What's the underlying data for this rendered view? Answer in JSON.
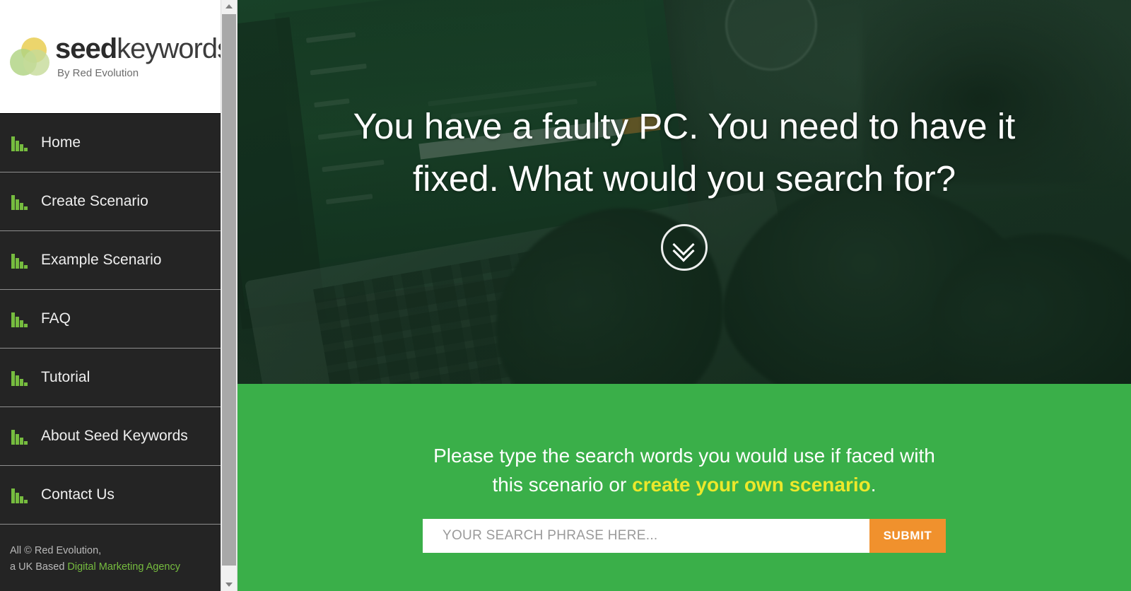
{
  "sidebar": {
    "logo": {
      "word_bold": "seed",
      "word_light": "keywords",
      "tagline": "By Red Evolution",
      "mark_colors": [
        "#e9ce52",
        "#b0d382",
        "#c6db98"
      ]
    },
    "nav_items": [
      {
        "label": "Home",
        "icon": "bar-chart-icon"
      },
      {
        "label": "Create Scenario",
        "icon": "bar-chart-icon"
      },
      {
        "label": "Example Scenario",
        "icon": "bar-chart-icon"
      },
      {
        "label": "FAQ",
        "icon": "bar-chart-icon"
      },
      {
        "label": "Tutorial",
        "icon": "bar-chart-icon"
      },
      {
        "label": "About Seed Keywords",
        "icon": "bar-chart-icon"
      },
      {
        "label": "Contact Us",
        "icon": "bar-chart-icon"
      }
    ],
    "footer": {
      "line1": "All © Red Evolution,",
      "line2_prefix": "a UK Based ",
      "line2_link": "Digital Marketing Agency"
    }
  },
  "scrollbar": {
    "up_arrow": "triangle-up-icon",
    "down_arrow": "triangle-down-icon",
    "thumb": "scrollbar-thumb"
  },
  "hero": {
    "title": "You have a faulty PC. You need to have it fixed. What would you search for?",
    "scroll_icon": "double-chevron-down-icon"
  },
  "green_section": {
    "copy_part1": "Please type the search words you would use if faced with this scenario or ",
    "copy_link": "create your own scenario",
    "copy_part2": ".",
    "search_placeholder": "YOUR SEARCH PHRASE HERE...",
    "search_value": "",
    "submit_label": "SUBMIT"
  },
  "colors": {
    "brand_green": "#3aaf49",
    "icon_green": "#76bc3f",
    "link_yellow": "#ece82b",
    "submit_orange": "#f0912d",
    "sidebar_dark": "#242424"
  }
}
